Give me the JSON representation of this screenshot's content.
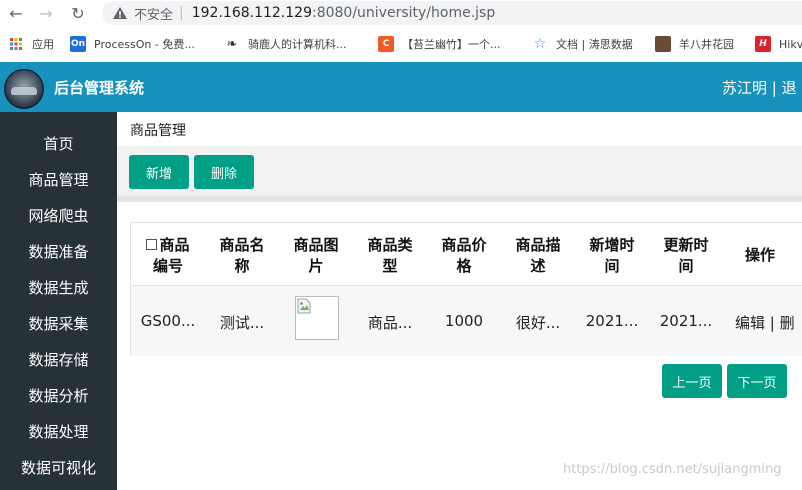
{
  "browser": {
    "insecure_label": "不安全",
    "url_host": "192.168.112.129",
    "url_path": ":8080/university/home.jsp",
    "bookmarks": [
      {
        "label": "应用"
      },
      {
        "label": "ProcessOn - 免费..."
      },
      {
        "label": "骑鹿人的计算机科..."
      },
      {
        "label": "【苔兰幽竹】一个..."
      },
      {
        "label": "文档 | 涛思数据"
      },
      {
        "label": "羊八井花园"
      },
      {
        "label": "Hikv"
      }
    ]
  },
  "header": {
    "title": "后台管理系统",
    "user": "苏江明 | 退"
  },
  "sidebar": {
    "items": [
      {
        "label": "首页"
      },
      {
        "label": "商品管理"
      },
      {
        "label": "网络爬虫"
      },
      {
        "label": "数据准备"
      },
      {
        "label": "数据生成"
      },
      {
        "label": "数据采集"
      },
      {
        "label": "数据存储"
      },
      {
        "label": "数据分析"
      },
      {
        "label": "数据处理"
      },
      {
        "label": "数据可视化"
      }
    ]
  },
  "main": {
    "breadcrumb": "商品管理",
    "add_label": "新增",
    "delete_label": "删除",
    "table": {
      "headers": [
        "商品编号",
        "商品名称",
        "商品图片",
        "商品类型",
        "商品价格",
        "商品描述",
        "新增时间",
        "更新时间",
        "操作"
      ],
      "header_lines": [
        [
          "商品",
          "编号"
        ],
        [
          "商品名",
          "称"
        ],
        [
          "商品图",
          "片"
        ],
        [
          "商品类",
          "型"
        ],
        [
          "商品价",
          "格"
        ],
        [
          "商品描",
          "述"
        ],
        [
          "新增时",
          "间"
        ],
        [
          "更新时",
          "间"
        ],
        [
          "操作",
          ""
        ]
      ],
      "rows": [
        {
          "id": "GS00...",
          "name": "测试...",
          "type": "商品...",
          "price": "1000",
          "desc": "很好...",
          "created": "2021...",
          "updated": "2021...",
          "edit": "编辑",
          "sep": "|",
          "del": "删"
        }
      ]
    },
    "prev_label": "上一页",
    "next_label": "下一页"
  },
  "watermark": "https://blog.csdn.net/sujiangming",
  "colors": {
    "header_bg": "#1991bd",
    "sidebar_bg": "#263238",
    "button": "#009f86"
  }
}
